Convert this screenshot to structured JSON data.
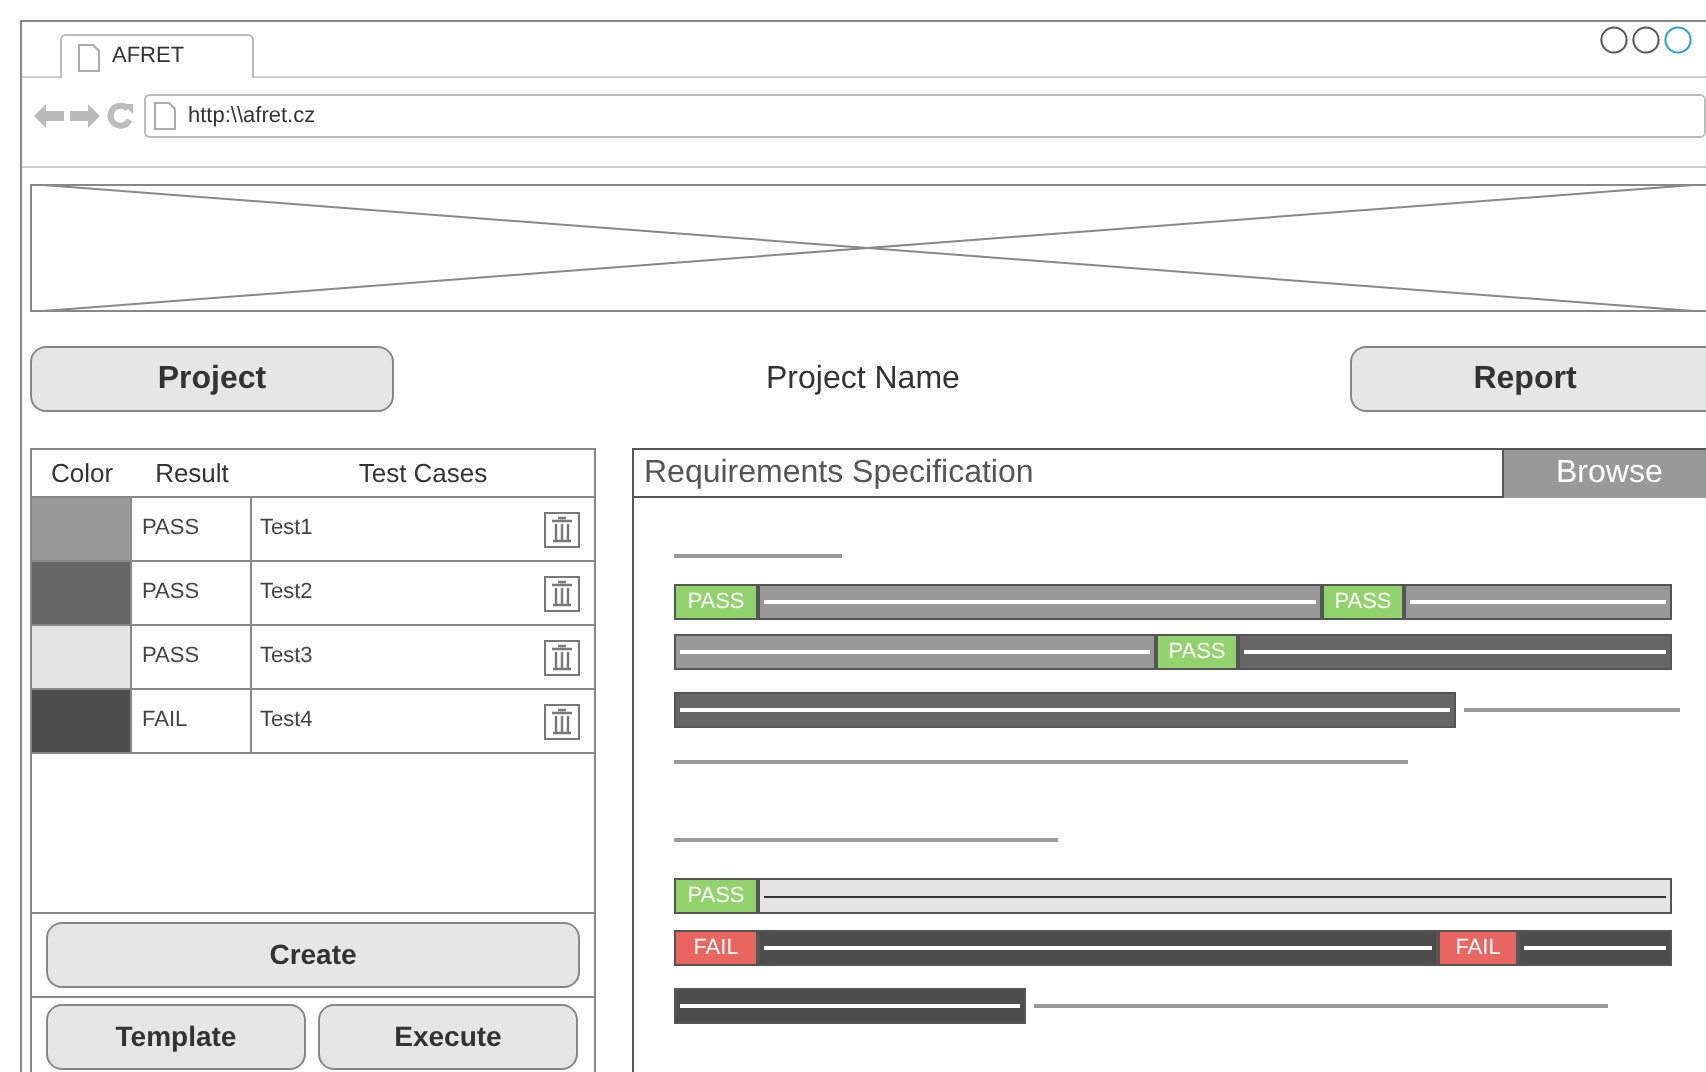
{
  "browser": {
    "tab_title": "AFRET",
    "url": "http:\\\\afret.cz"
  },
  "header": {
    "project_button": "Project",
    "project_name": "Project Name",
    "report_button": "Report"
  },
  "test_table": {
    "columns": [
      "Color",
      "Result",
      "Test Cases"
    ],
    "rows": [
      {
        "color": "#999999",
        "result": "PASS",
        "name": "Test1"
      },
      {
        "color": "#666666",
        "result": "PASS",
        "name": "Test2"
      },
      {
        "color": "#e5e5e5",
        "result": "PASS",
        "name": "Test3"
      },
      {
        "color": "#4d4d4d",
        "result": "FAIL",
        "name": "Test4"
      }
    ]
  },
  "actions": {
    "create": "Create",
    "template": "Template",
    "execute": "Execute"
  },
  "spec": {
    "title": "Requirements Specification",
    "browse_button": "Browse",
    "items": [
      {
        "kind": "rule"
      },
      {
        "kind": "bar",
        "pieces": [
          {
            "kind": "pass",
            "label": "PASS"
          },
          {
            "kind": "segment",
            "color": "#999999"
          },
          {
            "kind": "pass",
            "label": "PASS"
          },
          {
            "kind": "segment",
            "color": "#999999"
          }
        ]
      },
      {
        "kind": "bar",
        "pieces": [
          {
            "kind": "segment",
            "color": "#999999"
          },
          {
            "kind": "pass",
            "label": "PASS"
          },
          {
            "kind": "segment",
            "color": "#666666"
          }
        ]
      },
      {
        "kind": "bar",
        "pieces": [
          {
            "kind": "segment",
            "color": "#666666"
          },
          {
            "kind": "line"
          }
        ]
      },
      {
        "kind": "rule"
      },
      {
        "kind": "rule"
      },
      {
        "kind": "bar",
        "pieces": [
          {
            "kind": "pass",
            "label": "PASS"
          },
          {
            "kind": "segment",
            "color": "#e5e5e5"
          }
        ]
      },
      {
        "kind": "bar",
        "pieces": [
          {
            "kind": "fail",
            "label": "FAIL"
          },
          {
            "kind": "segment",
            "color": "#4d4d4d"
          },
          {
            "kind": "fail",
            "label": "FAIL"
          },
          {
            "kind": "segment",
            "color": "#4d4d4d"
          }
        ]
      },
      {
        "kind": "bar",
        "pieces": [
          {
            "kind": "segment",
            "color": "#4d4d4d"
          },
          {
            "kind": "line"
          }
        ]
      }
    ]
  }
}
